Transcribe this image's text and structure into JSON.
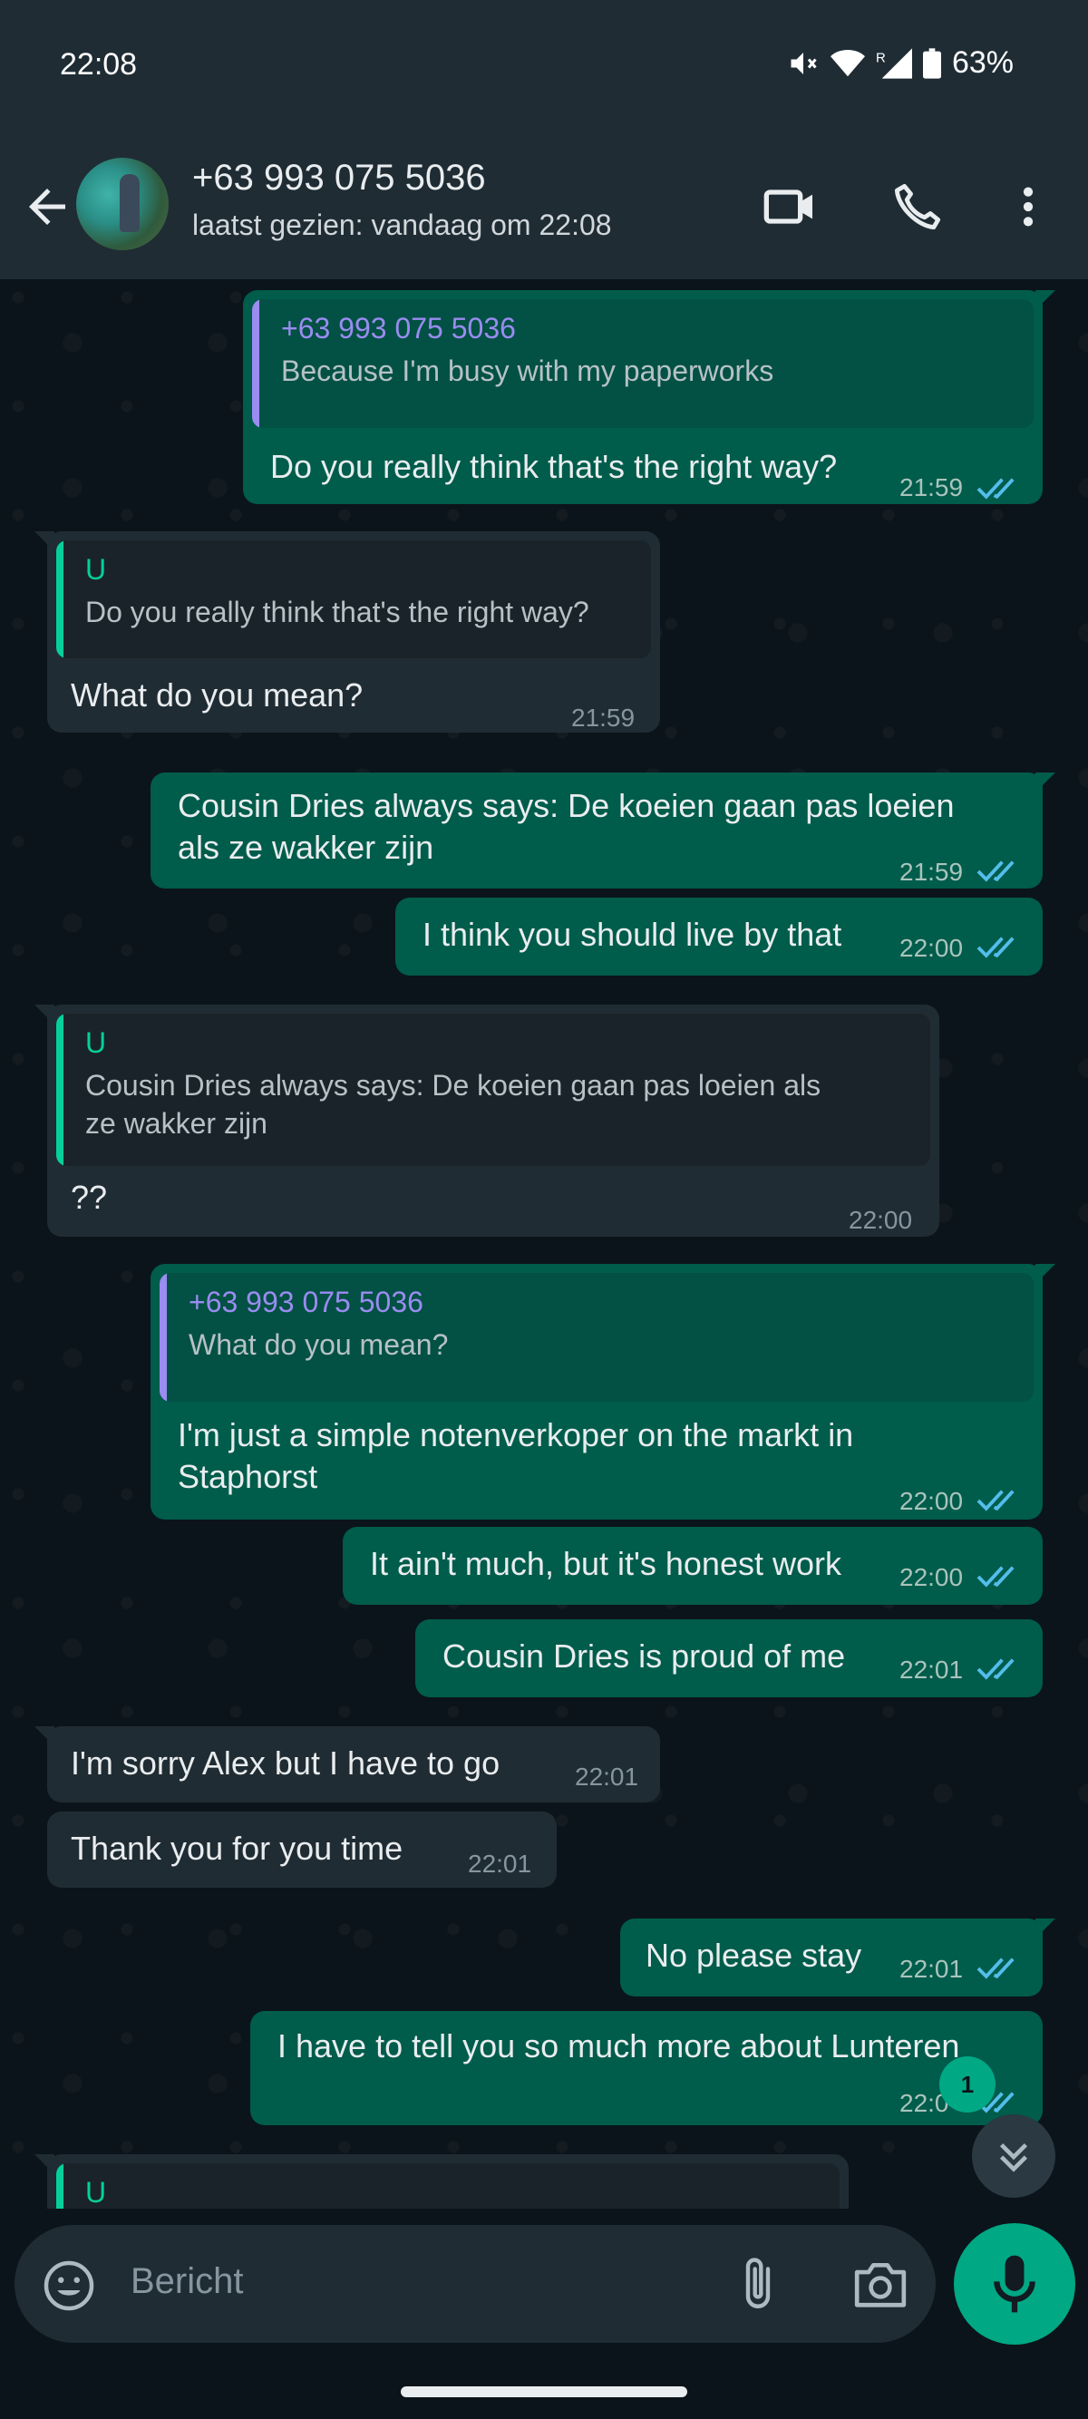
{
  "status_bar": {
    "time": "22:08",
    "battery": "63%",
    "roaming": "R"
  },
  "header": {
    "contact_name": "+63 993 075 5036",
    "last_seen": "laatst gezien: vandaag om 22:08"
  },
  "colors": {
    "outgoing_bubble": "#005c4b",
    "incoming_bubble": "#202c33",
    "accent": "#00a884",
    "tick_blue": "#53bdeb",
    "quote_self_name": "#9a8cf0",
    "quote_you_name": "#06cf9c"
  },
  "messages": [
    {
      "dir": "out",
      "quote_name": "+63 993 075 5036",
      "quote_text": "Because I'm busy with my paperworks",
      "text": "Do you really think that's the right way?",
      "time": "21:59"
    },
    {
      "dir": "in",
      "quote_name": "U",
      "quote_text": "Do you really think that's the right way?",
      "text": "What do you mean?",
      "time": "21:59"
    },
    {
      "dir": "out",
      "text_line1": "Cousin Dries always says: De koeien gaan pas loeien",
      "text_line2": "als ze wakker zijn",
      "time": "21:59"
    },
    {
      "dir": "out",
      "text": "I think you should live by that",
      "time": "22:00"
    },
    {
      "dir": "in",
      "quote_name": "U",
      "quote_line1": "Cousin Dries always says: De koeien gaan pas loeien als",
      "quote_line2": "ze wakker zijn",
      "text": "??",
      "time": "22:00"
    },
    {
      "dir": "out",
      "quote_name": "+63 993 075 5036",
      "quote_text": "What do you mean?",
      "text_line1": "I'm just a simple notenverkoper on the markt in",
      "text_line2": "Staphorst",
      "time": "22:00"
    },
    {
      "dir": "out",
      "text": "It ain't much, but it's honest work",
      "time": "22:00"
    },
    {
      "dir": "out",
      "text": "Cousin Dries is proud of me",
      "time": "22:01"
    },
    {
      "dir": "in",
      "text": "I'm sorry Alex but I have to go",
      "time": "22:01"
    },
    {
      "dir": "in",
      "text": "Thank you for you time",
      "time": "22:01"
    },
    {
      "dir": "out",
      "text": "No please stay",
      "time": "22:01"
    },
    {
      "dir": "out",
      "text": "I have to tell you so much more about Lunteren",
      "time": "22:0"
    },
    {
      "dir": "in",
      "quote_name": "U"
    }
  ],
  "unread_count": "1",
  "composer": {
    "placeholder": "Bericht"
  },
  "icons": [
    "back-arrow-icon",
    "video-call-icon",
    "phone-icon",
    "more-vert-icon",
    "double-tick-icon",
    "scroll-down-icon",
    "emoji-icon",
    "attach-icon",
    "camera-icon",
    "mic-icon"
  ]
}
